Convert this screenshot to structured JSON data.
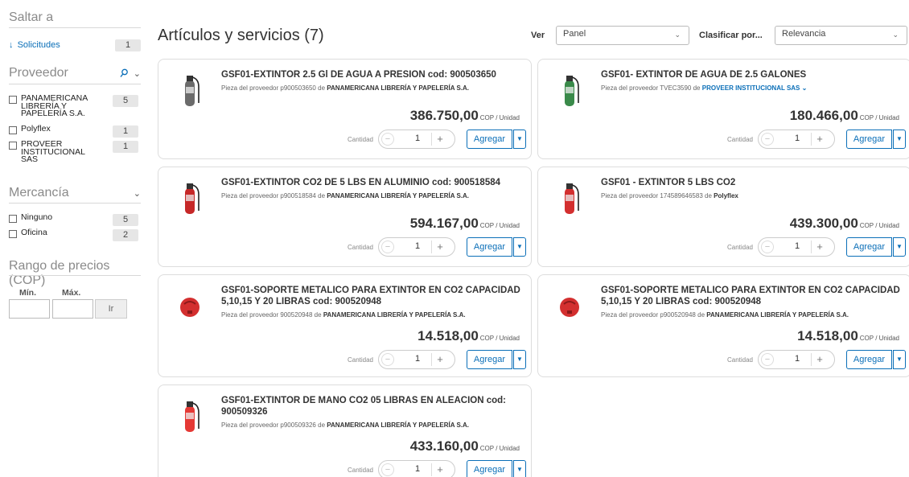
{
  "sidebar": {
    "jump_heading": "Saltar a",
    "jump_link": "Solicitudes",
    "jump_count": "1",
    "supplier_heading": "Proveedor",
    "suppliers": [
      {
        "label": "PANAMERICANA LIBRERÍA Y PAPELERÍA S.A.",
        "count": "5"
      },
      {
        "label": "Polyflex",
        "count": "1"
      },
      {
        "label": "PROVEER INSTITUCIONAL SAS",
        "count": "1"
      }
    ],
    "merch_heading": "Mercancía",
    "merch": [
      {
        "label": "Ninguno",
        "count": "5"
      },
      {
        "label": "Oficina",
        "count": "2"
      }
    ],
    "price_heading": "Rango de precios (COP)",
    "min_label": "Mín.",
    "max_label": "Máx.",
    "go_label": "Ir"
  },
  "header": {
    "title": "Artículos y servicios (7)",
    "view_label": "Ver",
    "view_value": "Panel",
    "sort_label": "Clasificar por...",
    "sort_value": "Relevancia"
  },
  "common": {
    "qty_label": "Cantidad",
    "qty_value": "1",
    "add_label": "Agregar",
    "unit": "COP / Unidad",
    "supplier_prefix": "Pieza del proveedor",
    "supplier_of": "de"
  },
  "items": [
    {
      "title": "GSF01-EXTINTOR 2.5 Gl DE AGUA A PRESION cod: 900503650",
      "part": "p900503650",
      "supplier": "PANAMERICANA LIBRERÍA Y PAPELERÍA S.A.",
      "price": "386.750,00",
      "thumb": "fire-extinguisher-icon",
      "accent": "#6b6b6b"
    },
    {
      "title": "GSF01- EXTINTOR DE AGUA DE 2.5 GALONES",
      "part": "TVEC3590",
      "supplier": "PROVEER INSTITUCIONAL SAS",
      "price": "180.466,00",
      "thumb": "fire-extinguisher-icon",
      "accent": "#3a8a4a"
    },
    {
      "title": "GSF01-EXTINTOR CO2 DE 5 LBS EN ALUMINIO cod: 900518584",
      "part": "p900518584",
      "supplier": "PANAMERICANA LIBRERÍA Y PAPELERÍA S.A.",
      "price": "594.167,00",
      "thumb": "fire-extinguisher-icon",
      "accent": "#c62828"
    },
    {
      "title": "GSF01 - EXTINTOR 5 LBS CO2",
      "part": "174589646583",
      "supplier": "Polyflex",
      "price": "439.300,00",
      "thumb": "fire-extinguisher-icon",
      "accent": "#d32f2f"
    },
    {
      "title": "GSF01-SOPORTE METALICO PARA EXTINTOR EN CO2 CAPACIDAD 5,10,15 Y 20 LIBRAS cod: 900520948",
      "part": "900520948",
      "supplier": "PANAMERICANA LIBRERÍA Y PAPELERÍA S.A.",
      "price": "14.518,00",
      "thumb": "bracket-icon",
      "accent": "#d32f2f"
    },
    {
      "title": "GSF01-SOPORTE METALICO PARA EXTINTOR EN CO2 CAPACIDAD 5,10,15 Y 20 LIBRAS cod: 900520948",
      "part": "p900520948",
      "supplier": "PANAMERICANA LIBRERÍA Y PAPELERÍA S.A.",
      "price": "14.518,00",
      "thumb": "bracket-icon",
      "accent": "#d32f2f"
    },
    {
      "title": "GSF01-EXTINTOR DE MANO CO2 05 LIBRAS EN ALEACION cod: 900509326",
      "part": "p900509326",
      "supplier": "PANAMERICANA LIBRERÍA Y PAPELERÍA S.A.",
      "price": "433.160,00",
      "thumb": "fire-extinguisher-icon",
      "accent": "#e53935"
    }
  ],
  "colors": {
    "link": "#0b6fb8",
    "border": "#dddddd"
  }
}
